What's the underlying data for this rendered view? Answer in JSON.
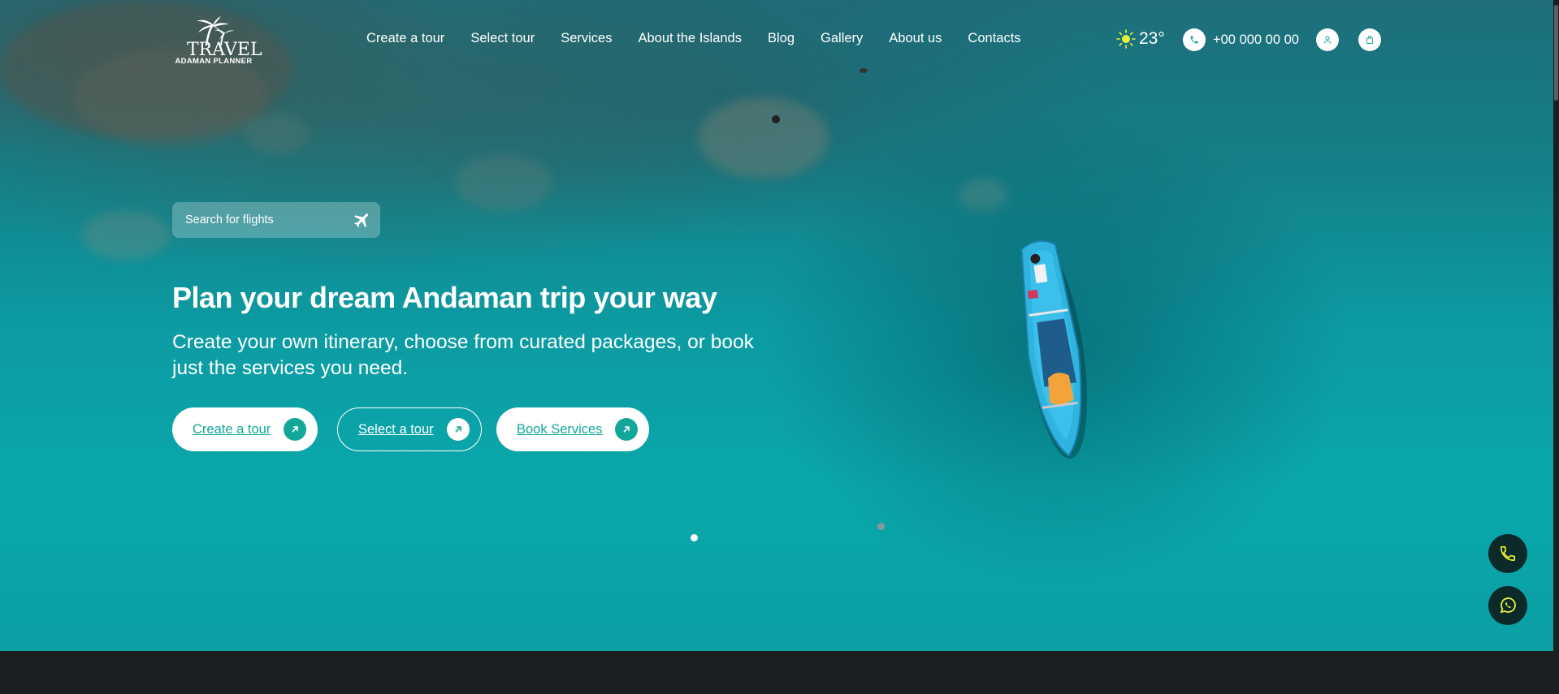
{
  "logo": {
    "main": "TRAVEL",
    "sub": "ADAMAN PLANNER"
  },
  "nav": {
    "items": [
      "Create a tour",
      "Select tour",
      "Services",
      "About the Islands",
      "Blog",
      "Gallery",
      "About us",
      "Contacts"
    ]
  },
  "header": {
    "temperature": "23°",
    "phone": "+00 000 00 00",
    "weather_icon": "sun-icon",
    "phone_icon": "phone-icon",
    "user_icon": "user-icon",
    "cart_icon": "cart-icon"
  },
  "search": {
    "placeholder": "Search for flights",
    "icon": "plane-icon"
  },
  "hero": {
    "title": "Plan your dream Andaman trip your way",
    "subtitle": "Create your own itinerary, choose from curated packages, or book just the services you need."
  },
  "cta": {
    "create": "Create a tour",
    "select": "Select a tour",
    "book": "Book Services"
  },
  "floating": {
    "call_icon": "phone-icon",
    "whatsapp_icon": "whatsapp-icon"
  },
  "colors": {
    "accent": "#13a79a",
    "sea": "#0aa8ab",
    "dark": "#1c1f22",
    "highlight": "#e8f13a"
  }
}
